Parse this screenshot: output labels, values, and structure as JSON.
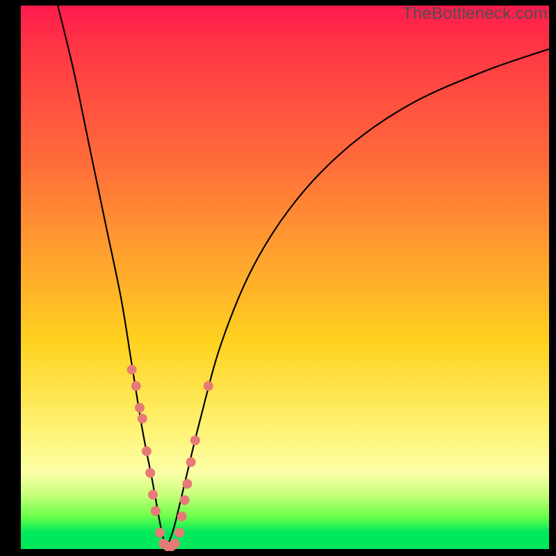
{
  "watermark": "TheBottleneck.com",
  "colors": {
    "curve": "#000000",
    "markers": "#e77a77",
    "frame": "#000000"
  },
  "chart_data": {
    "type": "line",
    "title": "",
    "xlabel": "",
    "ylabel": "",
    "xlim": [
      0,
      100
    ],
    "ylim": [
      0,
      100
    ],
    "note": "Axes are unlabeled in the image; values below are estimated from pixel positions on a 0–100 normalized scale (x left→right, y top→bottom inverted so 0 = bottom green band, 100 = top red). Curve is a V/notch shape with minimum near x≈27.",
    "series": [
      {
        "name": "curve-left-branch",
        "x": [
          7,
          10,
          13,
          16,
          19,
          21,
          23,
          25,
          26.5,
          27.5
        ],
        "y": [
          100,
          88,
          74,
          60,
          46,
          34,
          22,
          12,
          4,
          0
        ]
      },
      {
        "name": "curve-right-branch",
        "x": [
          27.5,
          29,
          31,
          34,
          38,
          44,
          52,
          62,
          74,
          88,
          100
        ],
        "y": [
          0,
          4,
          12,
          24,
          38,
          52,
          64,
          74,
          82,
          88,
          92
        ]
      }
    ],
    "markers": {
      "name": "data-points",
      "note": "Salmon dots clustered near the bottom of both branches",
      "points": [
        {
          "x": 21.0,
          "y": 33
        },
        {
          "x": 21.8,
          "y": 30
        },
        {
          "x": 22.5,
          "y": 26
        },
        {
          "x": 23.0,
          "y": 24
        },
        {
          "x": 23.8,
          "y": 18
        },
        {
          "x": 24.5,
          "y": 14
        },
        {
          "x": 25.0,
          "y": 10
        },
        {
          "x": 25.5,
          "y": 7
        },
        {
          "x": 26.3,
          "y": 3
        },
        {
          "x": 27.0,
          "y": 1
        },
        {
          "x": 27.8,
          "y": 0.5
        },
        {
          "x": 28.5,
          "y": 0.5
        },
        {
          "x": 29.2,
          "y": 1
        },
        {
          "x": 30.0,
          "y": 3
        },
        {
          "x": 30.5,
          "y": 6
        },
        {
          "x": 31.0,
          "y": 9
        },
        {
          "x": 31.5,
          "y": 12
        },
        {
          "x": 32.2,
          "y": 16
        },
        {
          "x": 33.0,
          "y": 20
        },
        {
          "x": 35.5,
          "y": 30
        }
      ]
    }
  }
}
